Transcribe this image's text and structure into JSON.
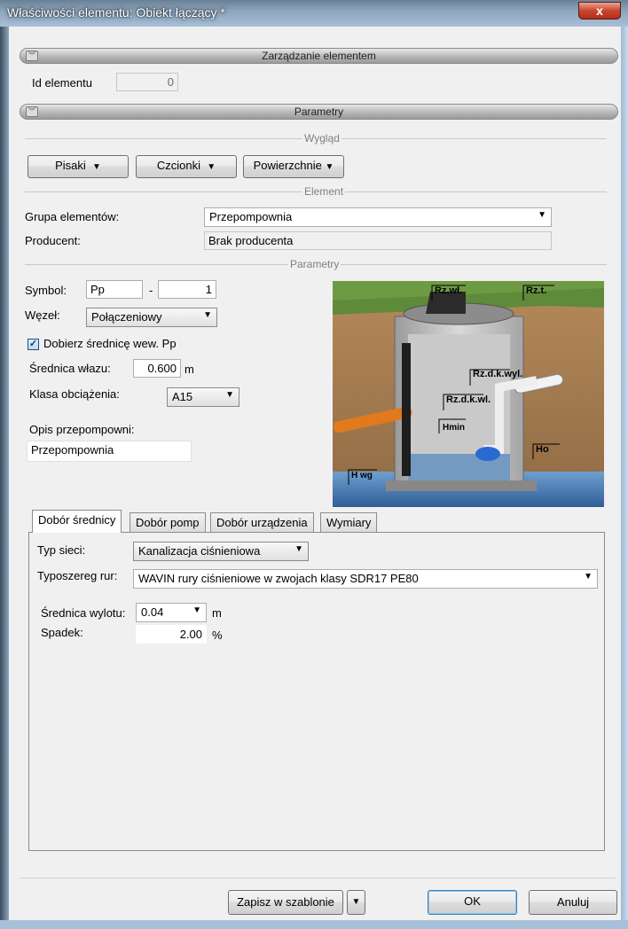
{
  "window": {
    "title": "Właściwości elementu: Obiekt łączący *",
    "close_label": "x"
  },
  "section_management": {
    "title": "Zarządzanie elementem"
  },
  "element_id": {
    "label": "Id elementu",
    "value": "0"
  },
  "section_parameters": {
    "title": "Parametry"
  },
  "appearance": {
    "group_label": "Wygląd",
    "pens_label": "Pisaki",
    "fonts_label": "Czcionki",
    "surfaces_label": "Powierzchnie"
  },
  "element": {
    "group_label": "Element",
    "group_field_label": "Grupa elementów:",
    "group_value": "Przepompownia",
    "producer_label": "Producent:",
    "producer_value": "Brak producenta"
  },
  "params": {
    "group_label": "Parametry",
    "symbol_label": "Symbol:",
    "symbol_prefix": "Pp",
    "symbol_dash": "-",
    "symbol_number": "1",
    "node_label": "Węzeł:",
    "node_value": "Połączeniowy",
    "auto_diameter_label": "Dobierz średnicę wew. Pp",
    "auto_diameter_checked": true,
    "manhole_diameter_label": "Średnica włazu:",
    "manhole_diameter_value": "0.600",
    "manhole_diameter_unit": "m",
    "load_class_label": "Klasa obciążenia:",
    "load_class_value": "A15",
    "description_label": "Opis przepompowni:",
    "description_value": "Przepompownia"
  },
  "diagram": {
    "labels": {
      "rzwl": "Rz.wł.",
      "rzt": "Rz.t.",
      "rzdkwyl": "Rz.d.k.wyl.",
      "rzdkwl": "Rz.d.k.wl.",
      "hmin": "Hmin",
      "ho": "Ho",
      "hwg": "H wg"
    }
  },
  "tabs": [
    {
      "label": "Dobór średnicy",
      "active": true
    },
    {
      "label": "Dobór pomp",
      "active": false
    },
    {
      "label": "Dobór urządzenia",
      "active": false
    },
    {
      "label": "Wymiary",
      "active": false
    }
  ],
  "diameter_tab": {
    "network_type_label": "Typ sieci:",
    "network_type_value": "Kanalizacja ciśnieniowa",
    "pipe_series_label": "Typoszereg rur:",
    "pipe_series_value": "WAVIN rury ciśnieniowe w zwojach klasy SDR17 PE80",
    "outlet_diameter_label": "Średnica wylotu:",
    "outlet_diameter_value": "0.04",
    "outlet_diameter_unit": "m",
    "slope_label": "Spadek:",
    "slope_value": "2.00",
    "slope_unit": "%"
  },
  "footer": {
    "save_template_label": "Zapisz w szablonie",
    "ok_label": "OK",
    "cancel_label": "Anuluj"
  }
}
